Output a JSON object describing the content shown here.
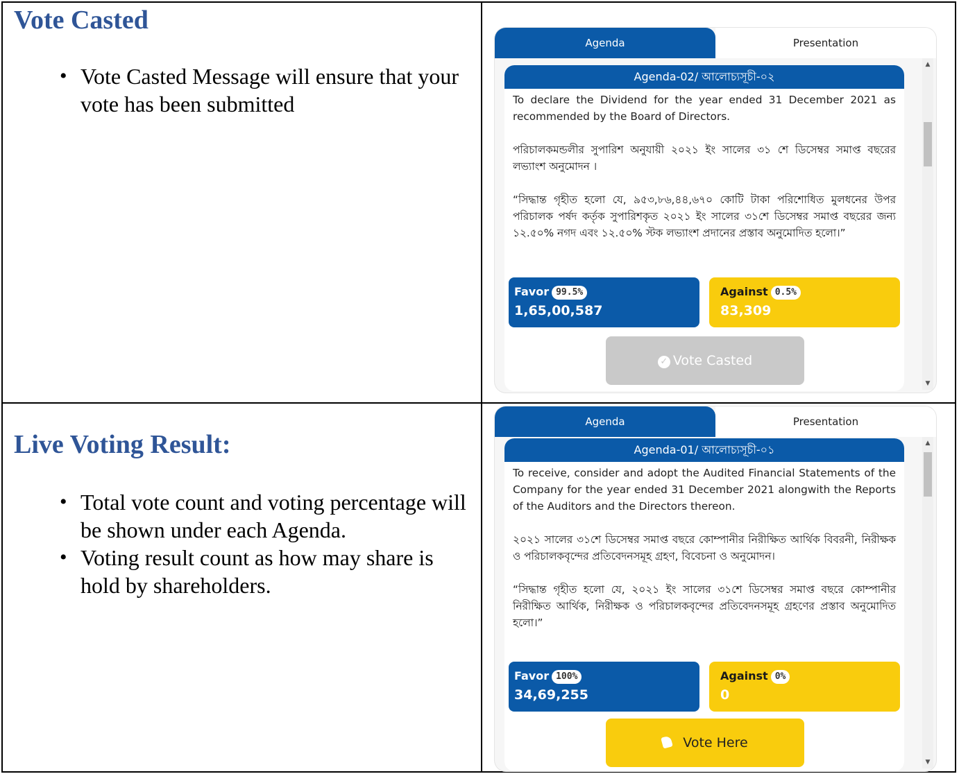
{
  "sections": [
    {
      "title": "Vote Casted",
      "bullets": [
        "Vote Casted Message will ensure that your vote has been submitted"
      ]
    },
    {
      "title": "Live Voting Result:",
      "bullets": [
        "Total vote count and voting percentage will be shown under each Agenda.",
        "Voting result count as how may share is hold by shareholders."
      ]
    }
  ],
  "panels": [
    {
      "tabs": {
        "agenda": "Agenda",
        "presentation": "Presentation"
      },
      "agenda_title": "Agenda-02/ আলোচ্যসূচী-০২",
      "paragraphs": [
        "To declare the Dividend for the year ended 31 December 2021 as recommended by the Board of Directors.",
        "পরিচালকমন্ডলীর সুপারিশ অনুযায়ী ২০২১ ইং সালের ৩১ শে ডিসেম্বর সমাপ্ত বছরের লভ্যাংশ অনুমোদন ।",
        "“সিদ্ধান্ত গৃহীত হলো যে, ৯৫৩,৮৬,৪৪,৬৭০ কোটি টাকা পরিশোধিত মুলধনের উপর পরিচালক পর্ষদ কর্তৃক সুপারিশকৃত ২০২১ ইং সালের ৩১শে ডিসেম্বর সমাপ্ত বছরের জন্য ১২.৫০% নগদ এবং ১২.৫০% স্টক লভ্যাংশ প্রদানের প্রস্তাব অনুমোদিত হলো।”"
      ],
      "favor": {
        "label": "Favor",
        "percent": "99.5%",
        "count": "1,65,00,587"
      },
      "against": {
        "label": "Against",
        "percent": "0.5%",
        "count": "83,309"
      },
      "button_label": "Vote Casted",
      "button_icon": "check-circle-icon",
      "button_state": "disabled"
    },
    {
      "tabs": {
        "agenda": "Agenda",
        "presentation": "Presentation"
      },
      "agenda_title": "Agenda-01/ আলোচ্যসূচী-০১",
      "paragraphs": [
        "To receive, consider and adopt the Audited Financial Statements of the Company for the year ended 31 December 2021 alongwith the Reports of the Auditors and the Directors thereon.",
        "২০২১ সালের ৩১শে ডিসেম্বর সমাপ্ত বছরে কোম্পানীর নিরীক্ষিত আর্থিক বিবরনী, নিরীক্ষক ও পরিচালকবৃন্দের প্রতিবেদনসমূহ গ্রহণ, বিবেচনা ও অনুমোদন।",
        "“সিদ্ধান্ত গৃহীত হলো যে, ২০২১ ইং সালের ৩১শে ডিসেম্বর সমাপ্ত বছরে কোম্পানীর নিরীক্ষিত আর্থিক, নিরীক্ষক ও পরিচালকবৃন্দের প্রতিবেদনসমূহ গ্রহণের প্রস্তাব অনুমোদিত হলো।”"
      ],
      "favor": {
        "label": "Favor",
        "percent": "100%",
        "count": "34,69,255"
      },
      "against": {
        "label": "Against",
        "percent": "0%",
        "count": "0"
      },
      "button_label": "Vote Here",
      "button_icon": "hand-vote-icon",
      "button_state": "enabled"
    }
  ],
  "colors": {
    "heading": "#2f5597",
    "primary_blue": "#0b5aa8",
    "against_yellow": "#f9cc0d",
    "disabled_gray": "#c9c9c9"
  }
}
